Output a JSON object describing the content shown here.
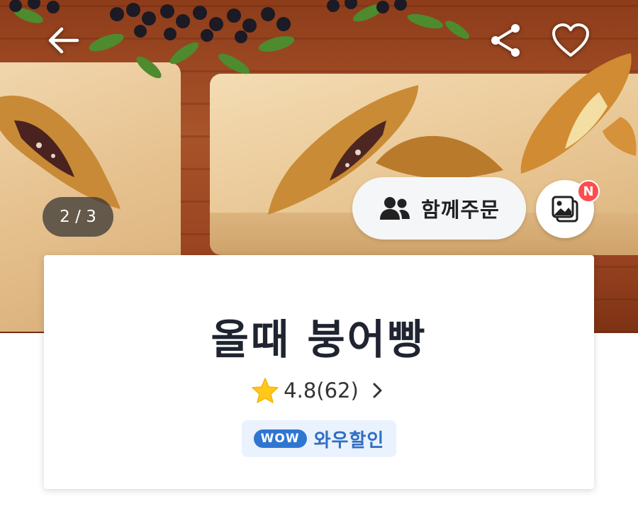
{
  "hero": {
    "counter": {
      "current": "2",
      "total": "3",
      "separator": " / "
    },
    "group_order_label": "함께주문",
    "photo_badge": "N"
  },
  "store": {
    "name": "올때 붕어빵",
    "rating": "4.8",
    "review_count": "(62)",
    "promo_pill": "WOW",
    "promo_text": "와우할인"
  },
  "icons": {
    "back": "arrow-left-icon",
    "share": "share-icon",
    "like": "heart-icon",
    "group": "people-icon",
    "photo": "photo-gallery-icon",
    "rating": "star-icon",
    "more": "chevron-right-icon"
  },
  "colors": {
    "promo_blue": "#2f76d2",
    "badge_red": "#ff4d4d",
    "star_yellow": "#ffc81a"
  }
}
